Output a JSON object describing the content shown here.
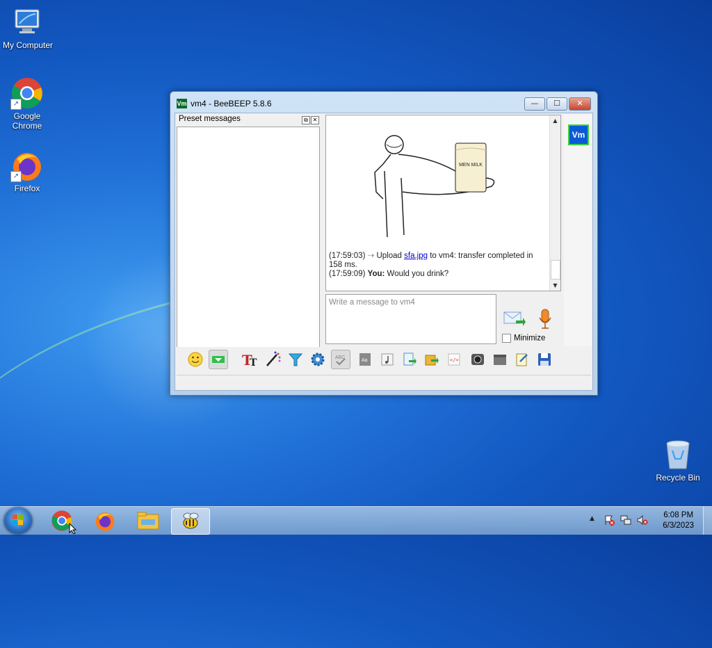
{
  "desktop": {
    "icons": [
      {
        "label": "My Computer"
      },
      {
        "label": "Google Chrome"
      },
      {
        "label": "Firefox"
      },
      {
        "label": "Recycle Bin"
      }
    ]
  },
  "window": {
    "app_icon_text": "Vm",
    "title": "vm4 - BeeBEEP 5.8.6",
    "buttons": {
      "minimize": "—",
      "maximize": "☐",
      "close": "✕"
    },
    "preset_panel": {
      "title": "Preset messages",
      "float_glyph": "⧉",
      "close_glyph": "✕"
    },
    "chat": {
      "image_caption": "MEN MILK",
      "lines": [
        {
          "time": "(17:59:03)",
          "pre": "Upload",
          "link": "sfa.jpg",
          "post": "to vm4: transfer completed in 158 ms."
        },
        {
          "time": "(17:59:09)",
          "sender": "You:",
          "text": "Would you drink?"
        }
      ]
    },
    "input": {
      "placeholder": "Write a message to vm4"
    },
    "minimize_label": "Minimize",
    "user_badge": "Vm",
    "toolbar_icons": [
      "emoticon-icon",
      "preset-messages-icon",
      "font-icon",
      "color-picker-icon",
      "filter-icon",
      "settings-gear-icon",
      "spellcheck-icon",
      "dictionary-icon",
      "sound-icon",
      "send-file-icon",
      "send-folder-icon",
      "code-icon",
      "screenshot-icon",
      "clear-icon",
      "notes-icon",
      "save-icon"
    ]
  },
  "taskbar": {
    "apps": [
      "chrome-icon",
      "firefox-icon",
      "explorer-icon",
      "beebeep-icon"
    ],
    "active_app": "beebeep-icon",
    "clock": {
      "time": "6:08 PM",
      "date": "6/3/2023"
    }
  },
  "colors": {
    "accent": "#0a5ad6",
    "link": "#0000cc",
    "badge_border": "#3cd13c"
  }
}
